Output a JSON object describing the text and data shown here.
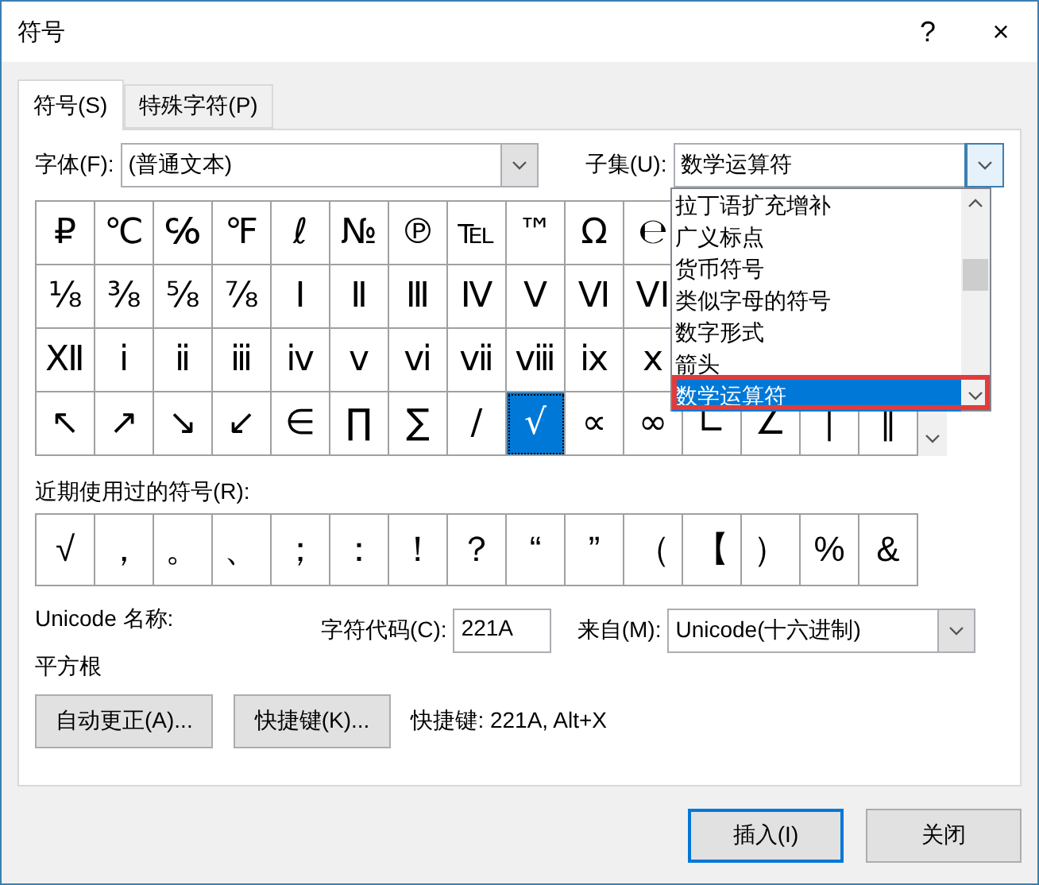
{
  "window": {
    "title": "符号",
    "help": "?",
    "close": "×"
  },
  "tabs": [
    {
      "label": "符号(S)",
      "selected": true
    },
    {
      "label": "特殊字符(P)",
      "selected": false
    }
  ],
  "font": {
    "label": "字体(F):",
    "value": "(普通文本)"
  },
  "subset": {
    "label": "子集(U):",
    "value": "数学运算符",
    "expanded": true,
    "options": [
      {
        "label": "拉丁语扩充增补",
        "selected": false
      },
      {
        "label": "广义标点",
        "selected": false
      },
      {
        "label": "货币符号",
        "selected": false
      },
      {
        "label": "类似字母的符号",
        "selected": false
      },
      {
        "label": "数字形式",
        "selected": false
      },
      {
        "label": "箭头",
        "selected": false
      },
      {
        "label": "数学运算符",
        "selected": true
      }
    ]
  },
  "symbol_grid": [
    [
      {
        "symbol": "₽",
        "selected": false
      },
      {
        "symbol": "℃",
        "selected": false
      },
      {
        "symbol": "℅",
        "selected": false
      },
      {
        "symbol": "℉",
        "selected": false
      },
      {
        "symbol": "ℓ",
        "selected": false
      },
      {
        "symbol": "№",
        "selected": false
      },
      {
        "symbol": "℗",
        "selected": false
      },
      {
        "symbol": "℡",
        "selected": false
      },
      {
        "symbol": "™",
        "selected": false
      },
      {
        "symbol": "Ω",
        "selected": false
      },
      {
        "symbol": "℮",
        "selected": false
      }
    ],
    [
      {
        "symbol": "⅛",
        "selected": false
      },
      {
        "symbol": "⅜",
        "selected": false
      },
      {
        "symbol": "⅝",
        "selected": false
      },
      {
        "symbol": "⅞",
        "selected": false
      },
      {
        "symbol": "Ⅰ",
        "selected": false
      },
      {
        "symbol": "Ⅱ",
        "selected": false
      },
      {
        "symbol": "Ⅲ",
        "selected": false
      },
      {
        "symbol": "Ⅳ",
        "selected": false
      },
      {
        "symbol": "Ⅴ",
        "selected": false
      },
      {
        "symbol": "Ⅵ",
        "selected": false
      },
      {
        "symbol": "VI",
        "selected": false
      }
    ],
    [
      {
        "symbol": "Ⅻ",
        "selected": false
      },
      {
        "symbol": "ⅰ",
        "selected": false
      },
      {
        "symbol": "ⅱ",
        "selected": false
      },
      {
        "symbol": "ⅲ",
        "selected": false
      },
      {
        "symbol": "ⅳ",
        "selected": false
      },
      {
        "symbol": "ⅴ",
        "selected": false
      },
      {
        "symbol": "ⅵ",
        "selected": false
      },
      {
        "symbol": "ⅶ",
        "selected": false
      },
      {
        "symbol": "ⅷ",
        "selected": false
      },
      {
        "symbol": "ⅸ",
        "selected": false
      },
      {
        "symbol": "ⅹ",
        "selected": false
      }
    ],
    [
      {
        "symbol": "↖",
        "selected": false
      },
      {
        "symbol": "↗",
        "selected": false
      },
      {
        "symbol": "↘",
        "selected": false
      },
      {
        "symbol": "↙",
        "selected": false
      },
      {
        "symbol": "∈",
        "selected": false
      },
      {
        "symbol": "∏",
        "selected": false
      },
      {
        "symbol": "∑",
        "selected": false
      },
      {
        "symbol": "∕",
        "selected": false
      },
      {
        "symbol": "√",
        "selected": true
      },
      {
        "symbol": "∝",
        "selected": false
      },
      {
        "symbol": "∞",
        "selected": false
      },
      {
        "symbol": "∟",
        "selected": false
      },
      {
        "symbol": "∠",
        "selected": false
      },
      {
        "symbol": "∣",
        "selected": false
      },
      {
        "symbol": "∥",
        "selected": false
      }
    ]
  ],
  "recent": {
    "label": "近期使用过的符号(R):",
    "symbols": [
      "√",
      "，",
      "。",
      "、",
      "；",
      "：",
      "！",
      "？",
      "“",
      "”",
      "（",
      "【",
      "）",
      "%",
      "&"
    ]
  },
  "unicode_name": {
    "label": "Unicode 名称:",
    "value": "平方根"
  },
  "char_code": {
    "label": "字符代码(C):",
    "value": "221A"
  },
  "from": {
    "label": "来自(M):",
    "value": "Unicode(十六进制)"
  },
  "buttons": [
    {
      "label": "自动更正(A)..."
    },
    {
      "label": "快捷键(K)..."
    }
  ],
  "shortcut_text": "快捷键: 221A, Alt+X",
  "footer_buttons": [
    {
      "label": "插入(I)",
      "default": true
    },
    {
      "label": "关闭",
      "default": false
    }
  ]
}
